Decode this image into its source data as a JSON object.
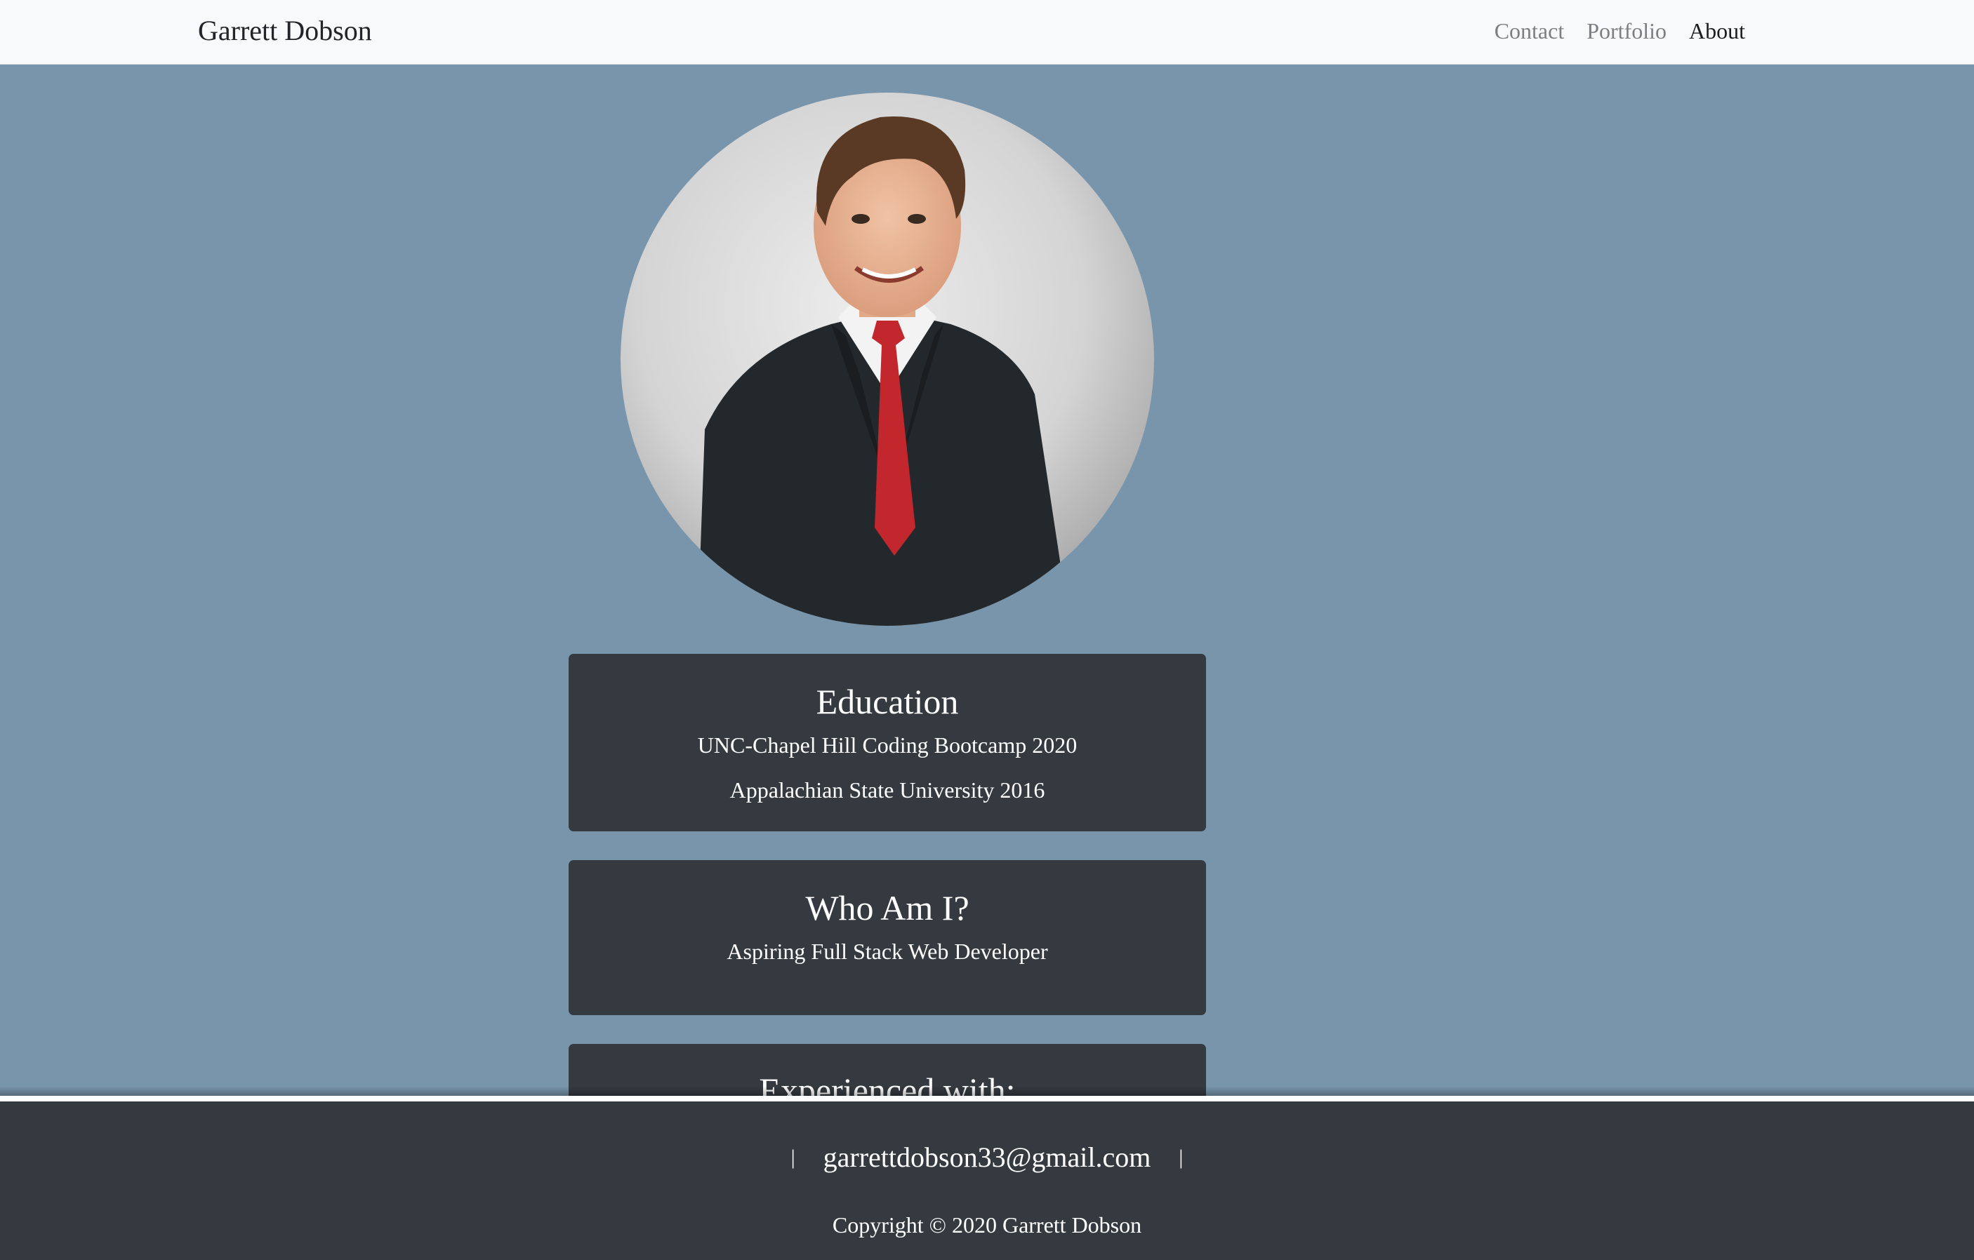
{
  "navbar": {
    "brand": "Garrett Dobson",
    "links": [
      {
        "label": "Contact",
        "active": false
      },
      {
        "label": "Portfolio",
        "active": false
      },
      {
        "label": "About",
        "active": true
      }
    ]
  },
  "profile": {
    "image_icon": "profile-photo-icon"
  },
  "education": {
    "title": "Education",
    "items": [
      "UNC-Chapel Hill Coding Bootcamp 2020",
      "Appalachian State University 2016"
    ]
  },
  "who": {
    "title": "Who Am I?",
    "text": "Aspiring Full Stack Web Developer"
  },
  "experience": {
    "title": "Experienced with:"
  },
  "footer": {
    "pipe_left": "|",
    "email": "garrettdobson33@gmail.com",
    "pipe_right": "|",
    "copyright": "Copyright © 2020 Garrett Dobson"
  },
  "colors": {
    "page_background": "#7995ac",
    "card_background": "#343a40",
    "navbar_background": "#f8f9fa",
    "footer_background": "#343a40"
  }
}
